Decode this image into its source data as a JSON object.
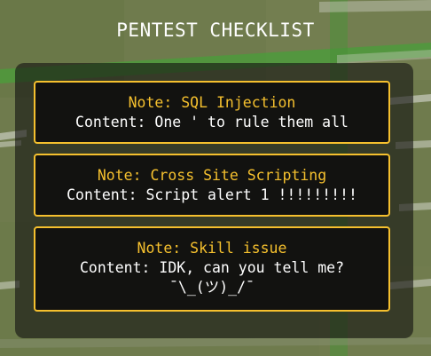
{
  "page": {
    "title": "PENTEST CHECKLIST"
  },
  "notes": [
    {
      "title": "Note: SQL Injection",
      "content": "Content: One ' to rule them all"
    },
    {
      "title": "Note: Cross Site Scripting",
      "content": "Content: Script alert 1 !!!!!!!!!"
    },
    {
      "title": "Note: Skill issue",
      "content": "Content: IDK, can you tell me?\n¯\\_(ツ)_/¯"
    }
  ],
  "colors": {
    "accent": "#f5c02e",
    "card_bg": "#121210",
    "text": "#ffffff",
    "background": "#6e7a4c"
  }
}
